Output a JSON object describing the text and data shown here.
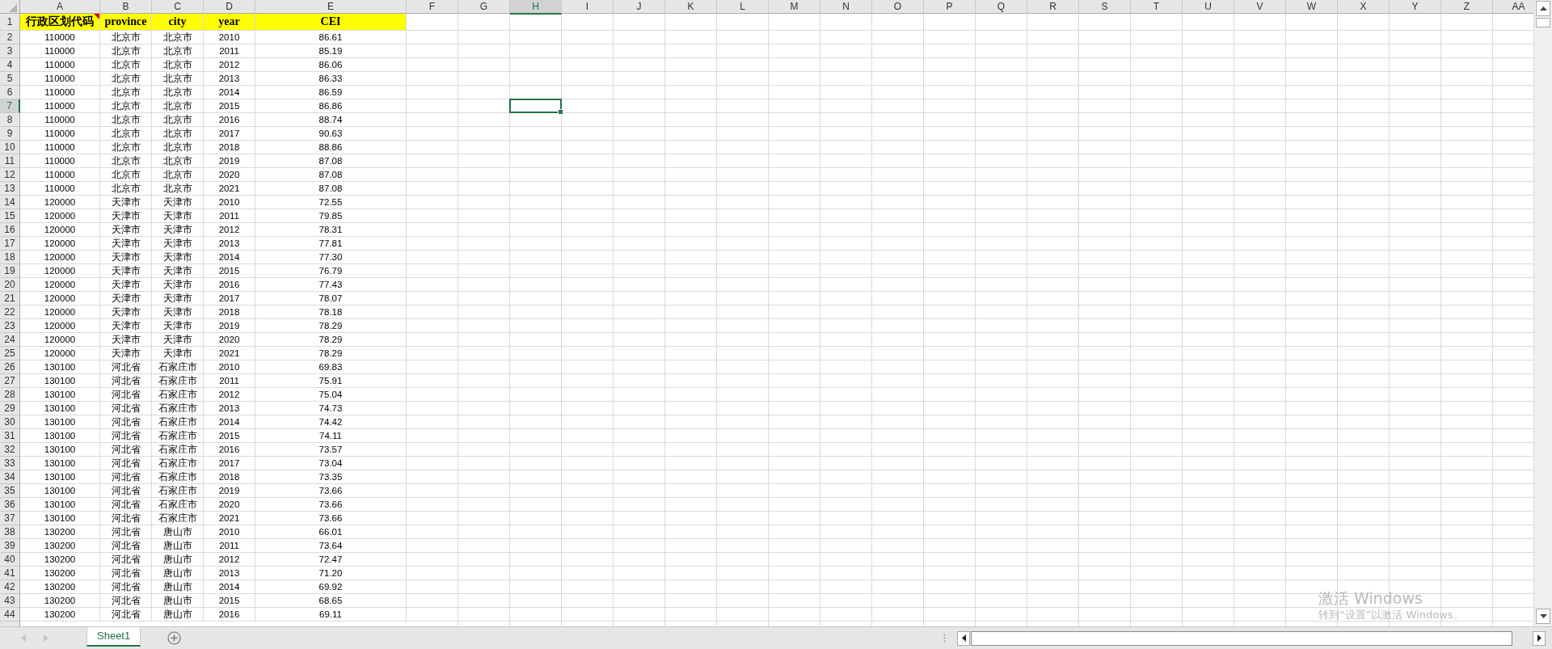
{
  "columns": [
    {
      "label": "A",
      "selected": false
    },
    {
      "label": "B",
      "selected": false
    },
    {
      "label": "C",
      "selected": false
    },
    {
      "label": "D",
      "selected": false
    },
    {
      "label": "E",
      "selected": false
    },
    {
      "label": "F",
      "selected": false
    },
    {
      "label": "G",
      "selected": false
    },
    {
      "label": "H",
      "selected": true
    },
    {
      "label": "I",
      "selected": false
    },
    {
      "label": "J",
      "selected": false
    },
    {
      "label": "K",
      "selected": false
    },
    {
      "label": "L",
      "selected": false
    },
    {
      "label": "M",
      "selected": false
    },
    {
      "label": "N",
      "selected": false
    },
    {
      "label": "O",
      "selected": false
    },
    {
      "label": "P",
      "selected": false
    },
    {
      "label": "Q",
      "selected": false
    },
    {
      "label": "R",
      "selected": false
    },
    {
      "label": "S",
      "selected": false
    },
    {
      "label": "T",
      "selected": false
    },
    {
      "label": "U",
      "selected": false
    },
    {
      "label": "V",
      "selected": false
    },
    {
      "label": "W",
      "selected": false
    },
    {
      "label": "X",
      "selected": false
    },
    {
      "label": "Y",
      "selected": false
    },
    {
      "label": "Z",
      "selected": false
    },
    {
      "label": "AA",
      "selected": false
    }
  ],
  "rows": [
    {
      "number": "1",
      "selected": false,
      "kind": "header",
      "highlighted": true,
      "cells": [
        {
          "text": "行政区划代码",
          "has_comment": true
        },
        {
          "text": "province",
          "has_comment": false
        },
        {
          "text": "city",
          "has_comment": false
        },
        {
          "text": "year",
          "has_comment": false
        },
        {
          "text": "CEI",
          "has_comment": false
        }
      ]
    },
    {
      "number": "2",
      "selected": false,
      "kind": "data",
      "cells": [
        "110000",
        "北京市",
        "北京市",
        "2010",
        "86.61"
      ]
    },
    {
      "number": "3",
      "selected": false,
      "kind": "data",
      "cells": [
        "110000",
        "北京市",
        "北京市",
        "2011",
        "85.19"
      ]
    },
    {
      "number": "4",
      "selected": false,
      "kind": "data",
      "cells": [
        "110000",
        "北京市",
        "北京市",
        "2012",
        "86.06"
      ]
    },
    {
      "number": "5",
      "selected": false,
      "kind": "data",
      "cells": [
        "110000",
        "北京市",
        "北京市",
        "2013",
        "86.33"
      ]
    },
    {
      "number": "6",
      "selected": false,
      "kind": "data",
      "cells": [
        "110000",
        "北京市",
        "北京市",
        "2014",
        "86.59"
      ]
    },
    {
      "number": "7",
      "selected": true,
      "kind": "data",
      "cells": [
        "110000",
        "北京市",
        "北京市",
        "2015",
        "86.86"
      ]
    },
    {
      "number": "8",
      "selected": false,
      "kind": "data",
      "cells": [
        "110000",
        "北京市",
        "北京市",
        "2016",
        "88.74"
      ]
    },
    {
      "number": "9",
      "selected": false,
      "kind": "data",
      "cells": [
        "110000",
        "北京市",
        "北京市",
        "2017",
        "90.63"
      ]
    },
    {
      "number": "10",
      "selected": false,
      "kind": "data",
      "cells": [
        "110000",
        "北京市",
        "北京市",
        "2018",
        "88.86"
      ]
    },
    {
      "number": "11",
      "selected": false,
      "kind": "data",
      "cells": [
        "110000",
        "北京市",
        "北京市",
        "2019",
        "87.08"
      ]
    },
    {
      "number": "12",
      "selected": false,
      "kind": "data",
      "cells": [
        "110000",
        "北京市",
        "北京市",
        "2020",
        "87.08"
      ]
    },
    {
      "number": "13",
      "selected": false,
      "kind": "data",
      "cells": [
        "110000",
        "北京市",
        "北京市",
        "2021",
        "87.08"
      ]
    },
    {
      "number": "14",
      "selected": false,
      "kind": "data",
      "cells": [
        "120000",
        "天津市",
        "天津市",
        "2010",
        "72.55"
      ]
    },
    {
      "number": "15",
      "selected": false,
      "kind": "data",
      "cells": [
        "120000",
        "天津市",
        "天津市",
        "2011",
        "79.85"
      ]
    },
    {
      "number": "16",
      "selected": false,
      "kind": "data",
      "cells": [
        "120000",
        "天津市",
        "天津市",
        "2012",
        "78.31"
      ]
    },
    {
      "number": "17",
      "selected": false,
      "kind": "data",
      "cells": [
        "120000",
        "天津市",
        "天津市",
        "2013",
        "77.81"
      ]
    },
    {
      "number": "18",
      "selected": false,
      "kind": "data",
      "cells": [
        "120000",
        "天津市",
        "天津市",
        "2014",
        "77.30"
      ]
    },
    {
      "number": "19",
      "selected": false,
      "kind": "data",
      "cells": [
        "120000",
        "天津市",
        "天津市",
        "2015",
        "76.79"
      ]
    },
    {
      "number": "20",
      "selected": false,
      "kind": "data",
      "cells": [
        "120000",
        "天津市",
        "天津市",
        "2016",
        "77.43"
      ]
    },
    {
      "number": "21",
      "selected": false,
      "kind": "data",
      "cells": [
        "120000",
        "天津市",
        "天津市",
        "2017",
        "78.07"
      ]
    },
    {
      "number": "22",
      "selected": false,
      "kind": "data",
      "cells": [
        "120000",
        "天津市",
        "天津市",
        "2018",
        "78.18"
      ]
    },
    {
      "number": "23",
      "selected": false,
      "kind": "data",
      "cells": [
        "120000",
        "天津市",
        "天津市",
        "2019",
        "78.29"
      ]
    },
    {
      "number": "24",
      "selected": false,
      "kind": "data",
      "cells": [
        "120000",
        "天津市",
        "天津市",
        "2020",
        "78.29"
      ]
    },
    {
      "number": "25",
      "selected": false,
      "kind": "data",
      "cells": [
        "120000",
        "天津市",
        "天津市",
        "2021",
        "78.29"
      ]
    },
    {
      "number": "26",
      "selected": false,
      "kind": "data",
      "cells": [
        "130100",
        "河北省",
        "石家庄市",
        "2010",
        "69.83"
      ]
    },
    {
      "number": "27",
      "selected": false,
      "kind": "data",
      "cells": [
        "130100",
        "河北省",
        "石家庄市",
        "2011",
        "75.91"
      ]
    },
    {
      "number": "28",
      "selected": false,
      "kind": "data",
      "cells": [
        "130100",
        "河北省",
        "石家庄市",
        "2012",
        "75.04"
      ]
    },
    {
      "number": "29",
      "selected": false,
      "kind": "data",
      "cells": [
        "130100",
        "河北省",
        "石家庄市",
        "2013",
        "74.73"
      ]
    },
    {
      "number": "30",
      "selected": false,
      "kind": "data",
      "cells": [
        "130100",
        "河北省",
        "石家庄市",
        "2014",
        "74.42"
      ]
    },
    {
      "number": "31",
      "selected": false,
      "kind": "data",
      "cells": [
        "130100",
        "河北省",
        "石家庄市",
        "2015",
        "74.11"
      ]
    },
    {
      "number": "32",
      "selected": false,
      "kind": "data",
      "cells": [
        "130100",
        "河北省",
        "石家庄市",
        "2016",
        "73.57"
      ]
    },
    {
      "number": "33",
      "selected": false,
      "kind": "data",
      "cells": [
        "130100",
        "河北省",
        "石家庄市",
        "2017",
        "73.04"
      ]
    },
    {
      "number": "34",
      "selected": false,
      "kind": "data",
      "cells": [
        "130100",
        "河北省",
        "石家庄市",
        "2018",
        "73.35"
      ]
    },
    {
      "number": "35",
      "selected": false,
      "kind": "data",
      "cells": [
        "130100",
        "河北省",
        "石家庄市",
        "2019",
        "73.66"
      ]
    },
    {
      "number": "36",
      "selected": false,
      "kind": "data",
      "cells": [
        "130100",
        "河北省",
        "石家庄市",
        "2020",
        "73.66"
      ]
    },
    {
      "number": "37",
      "selected": false,
      "kind": "data",
      "cells": [
        "130100",
        "河北省",
        "石家庄市",
        "2021",
        "73.66"
      ]
    },
    {
      "number": "38",
      "selected": false,
      "kind": "data",
      "cells": [
        "130200",
        "河北省",
        "唐山市",
        "2010",
        "66.01"
      ]
    },
    {
      "number": "39",
      "selected": false,
      "kind": "data",
      "cells": [
        "130200",
        "河北省",
        "唐山市",
        "2011",
        "73.64"
      ]
    },
    {
      "number": "40",
      "selected": false,
      "kind": "data",
      "cells": [
        "130200",
        "河北省",
        "唐山市",
        "2012",
        "72.47"
      ]
    },
    {
      "number": "41",
      "selected": false,
      "kind": "data",
      "cells": [
        "130200",
        "河北省",
        "唐山市",
        "2013",
        "71.20"
      ]
    },
    {
      "number": "42",
      "selected": false,
      "kind": "data",
      "cells": [
        "130200",
        "河北省",
        "唐山市",
        "2014",
        "69.92"
      ]
    },
    {
      "number": "43",
      "selected": false,
      "kind": "data",
      "cells": [
        "130200",
        "河北省",
        "唐山市",
        "2015",
        "68.65"
      ]
    },
    {
      "number": "44",
      "selected": false,
      "kind": "data",
      "cells": [
        "130200",
        "河北省",
        "唐山市",
        "2016",
        "69.11"
      ]
    }
  ],
  "sheet_tabs": [
    {
      "label": "Sheet1",
      "selected": true
    }
  ],
  "activation_notice": {
    "title": "激活 Windows",
    "text": "转到“设置”以激活 Windows。"
  }
}
